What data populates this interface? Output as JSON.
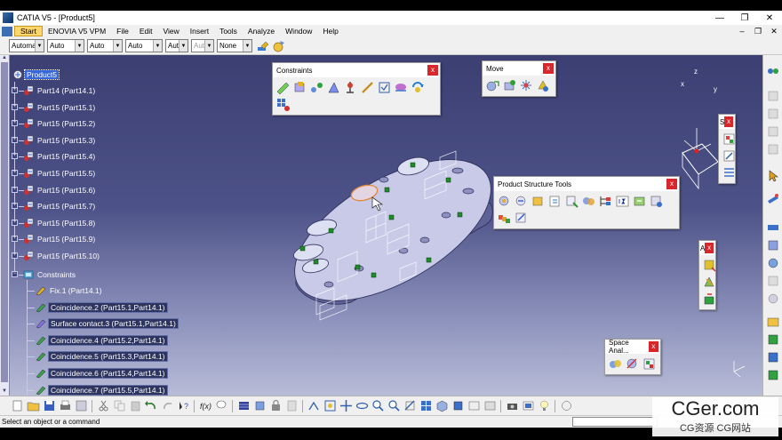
{
  "window": {
    "title": "CATIA V5 - [Product5]",
    "controls": [
      "—",
      "❐",
      "✕"
    ]
  },
  "menu": [
    "Start",
    "ENOVIA V5 VPM",
    "File",
    "Edit",
    "View",
    "Insert",
    "Tools",
    "Analyze",
    "Window",
    "Help"
  ],
  "mdi_controls": [
    "–",
    "❐",
    "✕"
  ],
  "combos": [
    {
      "value": "Automa",
      "disabled": false
    },
    {
      "value": "Auto",
      "disabled": false
    },
    {
      "value": "Auto",
      "disabled": false
    },
    {
      "value": "Auto",
      "disabled": false
    },
    {
      "value": "Aut",
      "disabled": false
    },
    {
      "value": "Aut",
      "disabled": true
    },
    {
      "value": "None",
      "disabled": false
    }
  ],
  "tree": {
    "root": "Product5",
    "parts": [
      "Part14 (Part14.1)",
      "Part15 (Part15.1)",
      "Part15 (Part15.2)",
      "Part15 (Part15.3)",
      "Part15 (Part15.4)",
      "Part15 (Part15.5)",
      "Part15 (Part15.6)",
      "Part15 (Part15.7)",
      "Part15 (Part15.8)",
      "Part15 (Part15.9)",
      "Part15 (Part15.10)"
    ],
    "constraints_label": "Constraints",
    "constraints": [
      "Fix.1 (Part14.1)",
      "Coincidence.2 (Part15.1,Part14.1)",
      "Surface contact.3 (Part15.1,Part14.1)",
      "Coincidence.4 (Part15.2,Part14.1)",
      "Coincidence.5 (Part15.3,Part14.1)",
      "Coincidence.6 (Part15.4,Part14.1)",
      "Coincidence.7 (Part15.5,Part14.1)"
    ]
  },
  "toolbars": {
    "constraints": {
      "title": "Constraints",
      "close": "x"
    },
    "move": {
      "title": "Move",
      "close": "x"
    },
    "product_structure": {
      "title": "Product Structure Tools",
      "close": "x"
    },
    "space_analysis": {
      "title": "Space Anal...",
      "close": "x"
    },
    "small_s": {
      "title": "S",
      "close": "x"
    },
    "small_a": {
      "title": "A",
      "close": "x"
    }
  },
  "compass": {
    "x": "x",
    "y": "y",
    "z": "z"
  },
  "status": {
    "message": "Select an object or a command"
  },
  "watermark": {
    "main": "CGer.com",
    "sub": "CG资源 CG网站"
  },
  "colors": {
    "selection": "#3a67d8",
    "close": "#d9262b",
    "start_menu": "#ffd66b"
  }
}
